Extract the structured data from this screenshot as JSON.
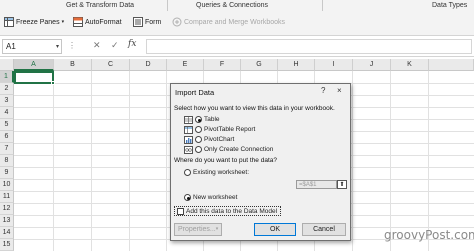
{
  "ribbon": {
    "groups": [
      "Get & Transform Data",
      "Queries & Connections",
      "Data Types"
    ],
    "freeze_panes": "Freeze Panes",
    "autoformat": "AutoFormat",
    "form": "Form",
    "compare_merge": "Compare and Merge Workbooks"
  },
  "formula_bar": {
    "name_box": "A1",
    "fx": "fx",
    "formula": ""
  },
  "sheet": {
    "columns": [
      "A",
      "B",
      "C",
      "D",
      "E",
      "F",
      "G",
      "H",
      "I",
      "J",
      "K"
    ],
    "rows": [
      "1",
      "2",
      "3",
      "4",
      "5",
      "6",
      "7",
      "8",
      "9",
      "10",
      "11",
      "12",
      "13",
      "14",
      "15"
    ],
    "active_cell": "A1"
  },
  "dialog": {
    "title": "Import Data",
    "help": "?",
    "close": "×",
    "view_prompt": "Select how you want to view this data in your workbook.",
    "options": [
      {
        "label": "Table",
        "icon": "table-icon",
        "selected": true
      },
      {
        "label": "PivotTable Report",
        "icon": "pivottable-icon",
        "selected": false
      },
      {
        "label": "PivotChart",
        "icon": "pivotchart-icon",
        "selected": false
      },
      {
        "label": "Only Create Connection",
        "icon": "connection-icon",
        "selected": false
      }
    ],
    "location_prompt": "Where do you want to put the data?",
    "existing_worksheet": "Existing worksheet:",
    "range_value": "=$A$1",
    "new_worksheet": "New worksheet",
    "location_selected": "new",
    "data_model_label": "Add this data to the Data Model",
    "data_model_checked": false,
    "properties_button": "Properties...",
    "ok_button": "OK",
    "cancel_button": "Cancel"
  },
  "watermark": "groovyPost.com",
  "colors": {
    "excel_green": "#217346",
    "ribbon_bg": "#f3f3f3",
    "dialog_bg": "#f0f0f0",
    "ok_border": "#0078d7"
  }
}
